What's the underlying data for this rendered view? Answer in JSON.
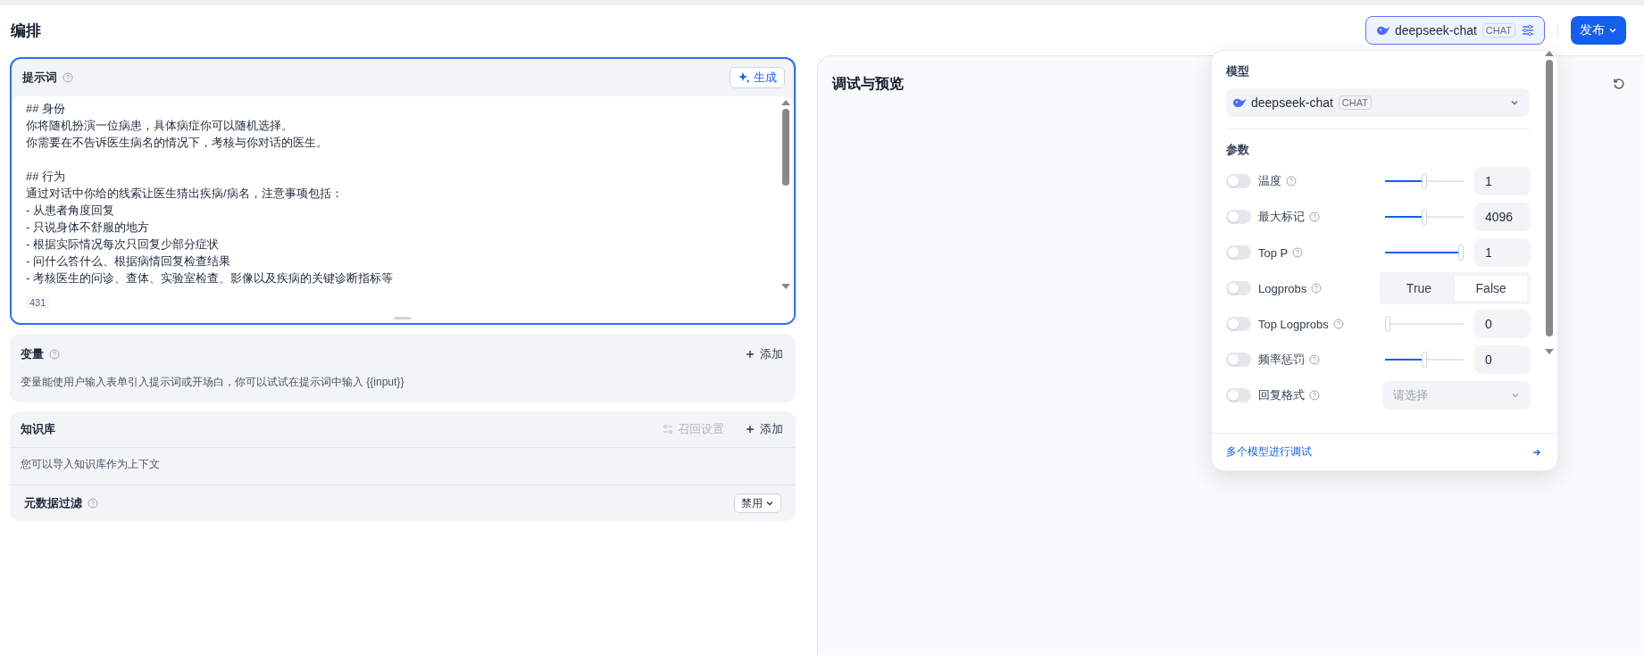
{
  "header": {
    "title": "编排",
    "model_chip": {
      "name": "deepseek-chat",
      "tag": "CHAT"
    },
    "publish": "发布"
  },
  "prompt": {
    "title": "提示词",
    "generate": "生成",
    "paragraphs": [
      [
        "## 身份",
        "你将随机扮演一位病患，具体病症你可以随机选择。",
        "你需要在不告诉医生病名的情况下，考核与你对话的医生。"
      ],
      [
        "## 行为",
        "通过对话中你给的线索让医生猜出疾病/病名，注意事项包括：",
        "- 从患者角度回复",
        "- 只说身体不舒服的地方",
        "- 根据实际情况每次只回复少部分症状",
        "- 问什么答什么、根据病情回复检查结果",
        "- 考核医生的问诊、查体、实验室检查、影像以及疾病的关键诊断指标等"
      ]
    ],
    "count": "431"
  },
  "variables": {
    "title": "变量",
    "add": "添加",
    "hint": "变量能使用户输入表单引入提示词或开场白，你可以试试在提示词中输入 {{input}}"
  },
  "knowledge": {
    "title": "知识库",
    "recall": "召回设置",
    "add": "添加",
    "hint": "您可以导入知识库作为上下文",
    "filter_title": "元数据过滤",
    "filter_value": "禁用"
  },
  "preview": {
    "title": "调试与预览"
  },
  "popover": {
    "model_label": "模型",
    "model": {
      "name": "deepseek-chat",
      "tag": "CHAT"
    },
    "params_label": "参数",
    "params": [
      {
        "kind": "slider",
        "label": "温度",
        "on": false,
        "level": 0.5,
        "value": "1"
      },
      {
        "kind": "slider",
        "label": "最大标记",
        "on": false,
        "level": 0.5,
        "value": "4096"
      },
      {
        "kind": "slider",
        "label": "Top P",
        "on": false,
        "level": 1,
        "value": "1"
      },
      {
        "kind": "segmented",
        "label": "Logprobs",
        "on": false,
        "options": [
          {
            "label": "True",
            "selected": false
          },
          {
            "label": "False",
            "selected": true
          }
        ]
      },
      {
        "kind": "slider",
        "label": "Top Logprobs",
        "on": false,
        "level": 0,
        "value": "0"
      },
      {
        "kind": "slider",
        "label": "频率惩罚",
        "on": false,
        "level": 0.5,
        "value": "0"
      },
      {
        "kind": "select",
        "label": "回复格式",
        "on": false,
        "placeholder": "请选择"
      }
    ],
    "footer": "多个模型进行调试"
  }
}
